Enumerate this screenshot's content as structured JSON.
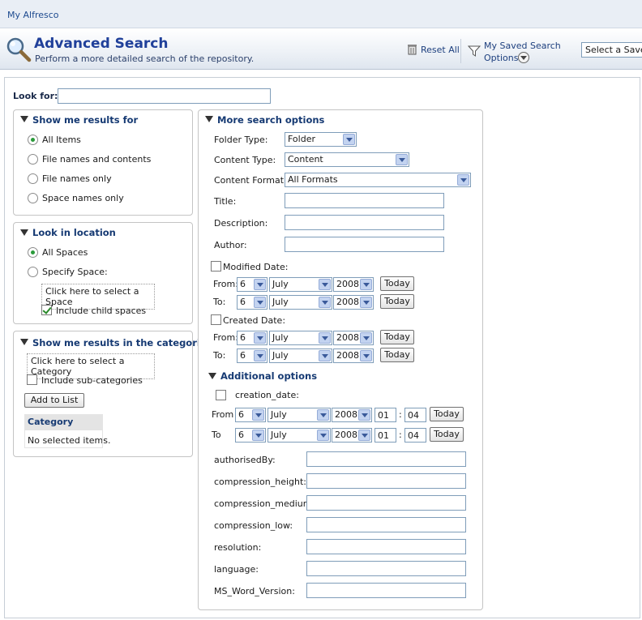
{
  "breadcrumb": "My Alfresco",
  "header": {
    "title": "Advanced Search",
    "subtitle": "Perform a more detailed search of the repository.",
    "reset_all": "Reset All",
    "saved_search_line1": "My Saved Search",
    "saved_search_line2": "Options",
    "saved_select": "Select a Saved"
  },
  "look_for": {
    "label": "Look for:",
    "value": ""
  },
  "results_for": {
    "title": "Show me results for",
    "options": [
      "All Items",
      "File names and contents",
      "File names only",
      "Space names only"
    ],
    "selected": "All Items"
  },
  "location": {
    "title": "Look in location",
    "all_spaces": "All Spaces",
    "specify_space": "Specify Space:",
    "select_space": "Click here to select a Space",
    "include_child": "Include child spaces"
  },
  "categories": {
    "title": "Show me results in the categories",
    "select_category": "Click here to select a Category",
    "include_sub": "Include sub-categories",
    "add_button": "Add to List",
    "table_header": "Category",
    "empty": "No selected items."
  },
  "more_options": {
    "title": "More search options",
    "folder_type_label": "Folder Type:",
    "folder_type": "Folder",
    "content_type_label": "Content Type:",
    "content_type": "Content",
    "content_format_label": "Content Format:",
    "content_format": "All Formats",
    "title_label": "Title:",
    "description_label": "Description:",
    "author_label": "Author:",
    "modified_date": "Modified Date:",
    "created_date": "Created Date:",
    "from": "From:",
    "to": "To:",
    "today": "Today",
    "day": "6",
    "month": "July",
    "year": "2008"
  },
  "additional": {
    "title": "Additional options",
    "creation_date": "creation_date:",
    "from": "From",
    "to": "To",
    "hour": "01",
    "minute": "04",
    "colon": ":",
    "fields": [
      "authorisedBy:",
      "compression_height:",
      "compression_medium:",
      "compression_low:",
      "resolution:",
      "language:",
      "MS_Word_Version:"
    ]
  }
}
